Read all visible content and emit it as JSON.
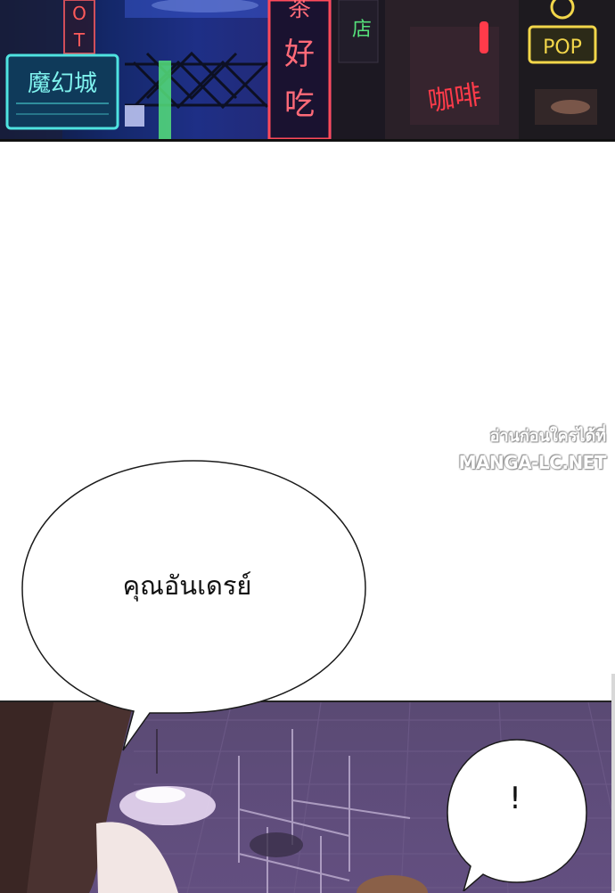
{
  "top_panel": {
    "sign_hotel_letters": [
      "O",
      "T"
    ],
    "sign_left_chinese": "魔幻城",
    "sign_center_chinese": [
      "茶",
      "好",
      "吃"
    ],
    "sign_small_chinese": "店",
    "sign_right_chinese": "咖啡",
    "sign_pop": "POP",
    "colors": {
      "neon_cyan": "#4fe3e0",
      "neon_red": "#ff3b4a",
      "neon_yellow": "#f2d64a",
      "neon_green": "#55e07a"
    }
  },
  "watermark": {
    "line1": "อ่านก่อนใครได้ที่",
    "line2": "MANGA-LC.NET"
  },
  "speech_bubbles": {
    "main_text": "คุณอันเดรย์",
    "small_text": "!"
  },
  "bottom_panel": {
    "colors": {
      "background": "#5e4c7a",
      "lamp_glow": "#e8d8f2",
      "hair": "#4a3230"
    }
  }
}
